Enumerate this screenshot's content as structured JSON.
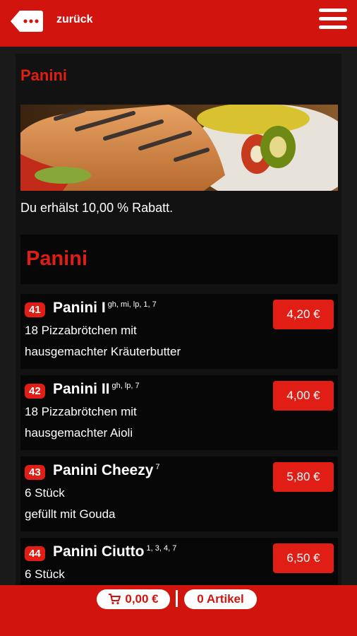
{
  "header": {
    "back_label": "zurück",
    "accent_color": "#d2140f"
  },
  "category": {
    "title": "Panini",
    "discount_text": "Du erhälst 10,00 % Rabatt.",
    "section_title": "Panini"
  },
  "items": [
    {
      "number": "41",
      "name": "Panini I",
      "allergens": "gh, mi, lp, 1, 7",
      "desc1": "18 Pizzabrötchen mit",
      "desc2": "hausgemachter Kräuterbutter",
      "price": "4,20 €"
    },
    {
      "number": "42",
      "name": "Panini II",
      "allergens": "gh, lp, 7",
      "desc1": "18 Pizzabrötchen mit",
      "desc2": "hausgemachter Aioli",
      "price": "4,00 €"
    },
    {
      "number": "43",
      "name": "Panini Cheezy",
      "allergens": "7",
      "desc1": "6 Stück",
      "desc2": "gefüllt mit Gouda",
      "price": "5,80 €"
    },
    {
      "number": "44",
      "name": "Panini Ciutto",
      "allergens": "1, 3, 4, 7",
      "desc1": "6 Stück",
      "desc2": "",
      "price": "6,50 €"
    }
  ],
  "cart": {
    "total": "0,00 €",
    "count_label": "0 Artikel"
  }
}
